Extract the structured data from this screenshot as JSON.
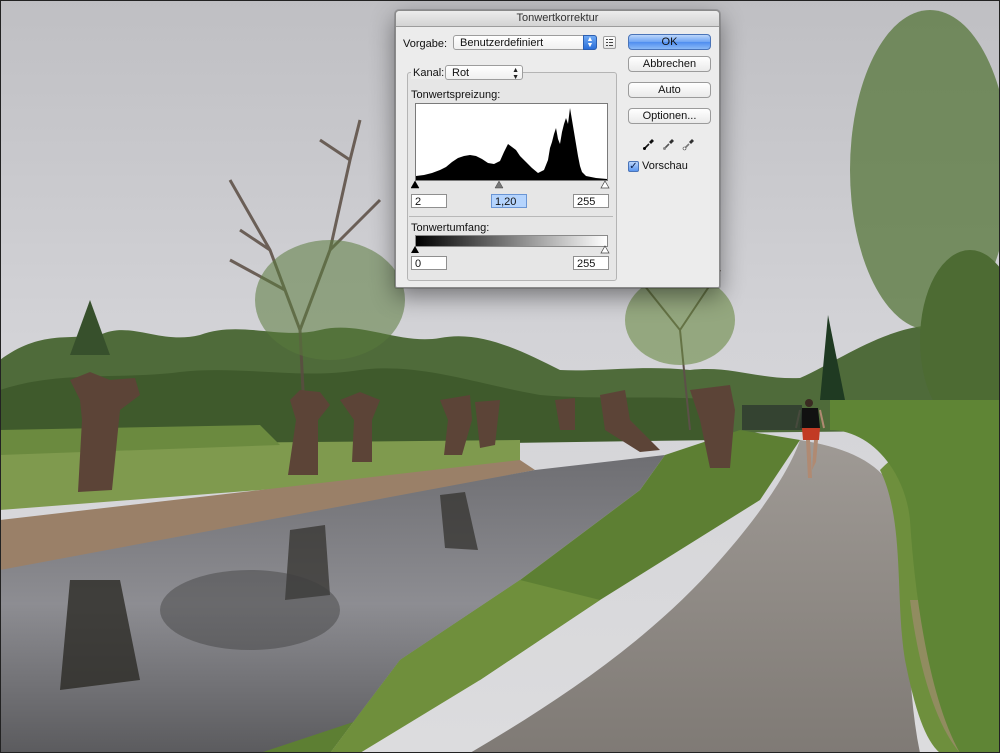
{
  "dialog": {
    "title": "Tonwertkorrektur",
    "preset_label": "Vorgabe:",
    "preset_value": "Benutzerdefiniert",
    "channel_label": "Kanal:",
    "channel_value": "Rot",
    "input_levels_label": "Tonwertspreizung:",
    "input_black": "2",
    "input_gamma": "1,20",
    "input_white": "255",
    "output_levels_label": "Tonwertumfang:",
    "output_black": "0",
    "output_white": "255",
    "buttons": {
      "ok": "OK",
      "cancel": "Abbrechen",
      "auto": "Auto",
      "options": "Optionen..."
    },
    "preview_label": "Vorschau",
    "preview_checked": true,
    "icons": {
      "preset_menu": "preset-options-icon",
      "black_eyedropper": "black-eyedropper-icon",
      "gray_eyedropper": "gray-eyedropper-icon",
      "white_eyedropper": "white-eyedropper-icon"
    }
  },
  "colors": {
    "accent": "#4f8eef",
    "dialog_bg": "#ececec"
  }
}
